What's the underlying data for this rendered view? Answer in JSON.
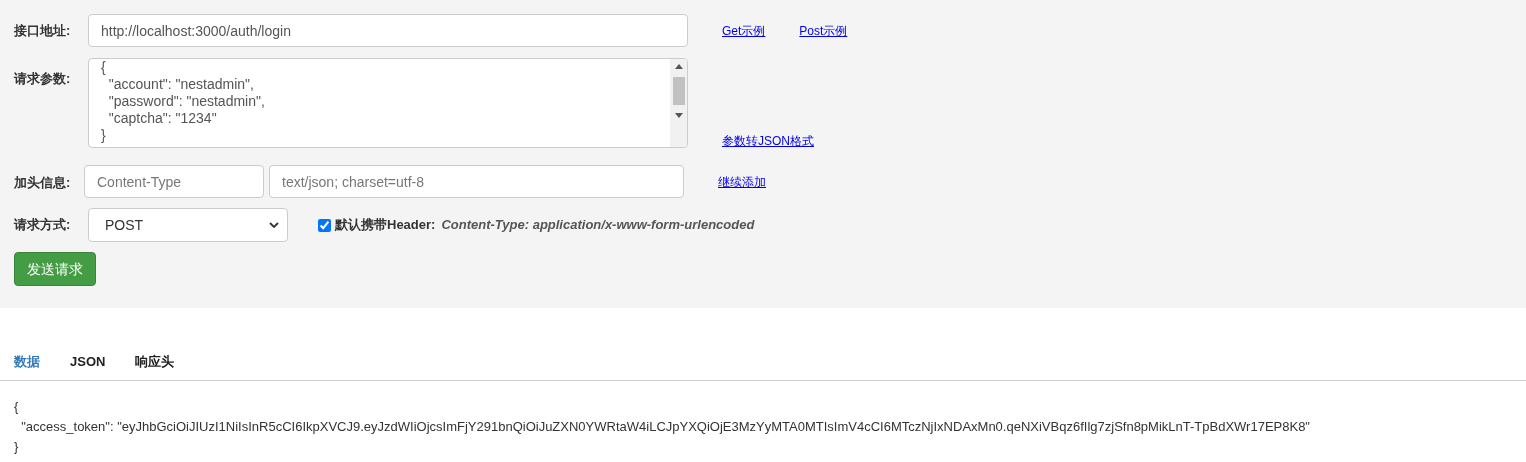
{
  "form": {
    "url": {
      "label": "接口地址:",
      "value": "http://localhost:3000/auth/login"
    },
    "example_links": [
      "Get示例",
      "Post示例"
    ],
    "params": {
      "label": "请求参数:",
      "lines": [
        "{",
        "  \"account\": \"nestadmin\",",
        "  \"password\": \"nestadmin\",",
        "  \"captcha\": \"1234\"",
        "}"
      ]
    },
    "convert_link": "参数转JSON格式",
    "headers": {
      "label": "加头信息:",
      "key_placeholder": "Content-Type",
      "value_placeholder": "text/json; charset=utf-8",
      "add_link": "继续添加"
    },
    "method": {
      "label": "请求方式:",
      "value": "POST"
    },
    "default_header": {
      "checked": true,
      "label": "默认携带Header:",
      "value": "Content-Type: application/x-www-form-urlencoded"
    },
    "send_button": "发送请求"
  },
  "tabs": [
    {
      "label": "数据",
      "selected": true
    },
    {
      "label": "JSON",
      "selected": false
    },
    {
      "label": "响应头",
      "selected": false
    }
  ],
  "response": {
    "lines": [
      "{",
      "  \"access_token\": \"eyJhbGciOiJIUzI1NiIsInR5cCI6IkpXVCJ9.eyJzdWIiOjcsImFjY291bnQiOiJuZXN0YWRtaW4iLCJpYXQiOjE3MzYyMTA0MTIsImV4cCI6MTczNjIxNDAxMn0.qeNXiVBqz6fIlg7zjSfn8pMikLnT-TpBdXWr17EP8K8\"",
      "}"
    ]
  }
}
